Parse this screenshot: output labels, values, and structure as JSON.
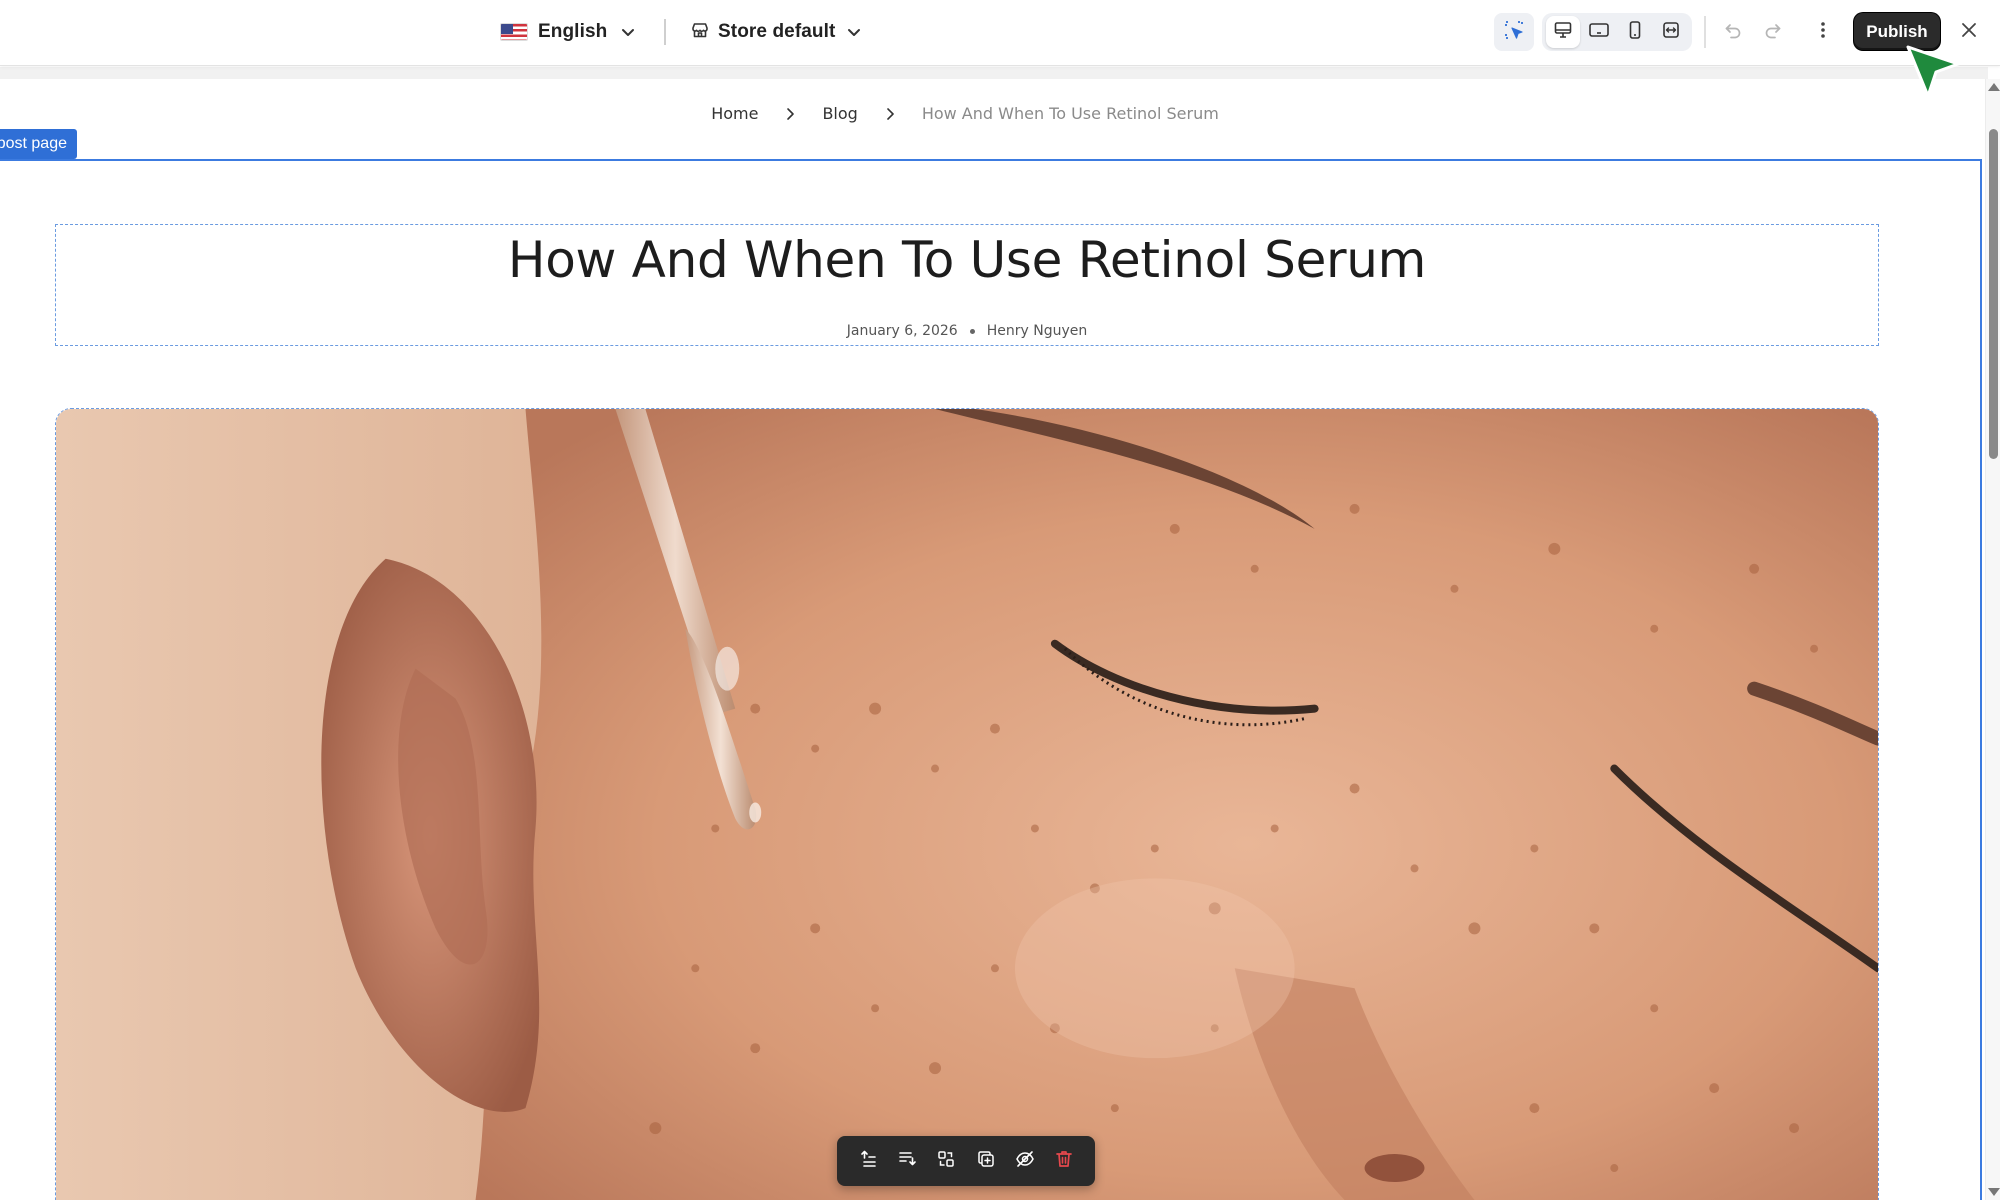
{
  "topbar": {
    "language": {
      "label": "English",
      "flag_icon": "us-flag-icon"
    },
    "store": {
      "label": "Store default",
      "icon": "store-icon"
    },
    "tools": {
      "select_icon": "element-select-icon",
      "devices": [
        "desktop-icon",
        "tablet-landscape-icon",
        "mobile-icon",
        "fit-width-icon"
      ],
      "active_device": "desktop-icon"
    },
    "undo_icon": "undo-icon",
    "redo_icon": "redo-icon",
    "more_icon": "more-vertical-icon",
    "publish_label": "Publish",
    "close_icon": "close-icon",
    "accent_color": "#2f6fd6",
    "cursor_color": "#1f8a3d"
  },
  "breadcrumb": {
    "items": [
      "Home",
      "Blog"
    ],
    "current": "How And When To Use Retinol Serum"
  },
  "section_tag": "post page",
  "post": {
    "title": "How And When To Use Retinol Serum",
    "date": "January 6, 2026",
    "author": "Henry Nguyen",
    "image_icon": "face-with-serum-dropper-photo"
  },
  "floating_toolbar": {
    "icons": [
      "move-up-icon",
      "move-down-icon",
      "replace-icon",
      "duplicate-icon",
      "hide-icon",
      "delete-icon"
    ],
    "delete_color": "#e5484d"
  }
}
